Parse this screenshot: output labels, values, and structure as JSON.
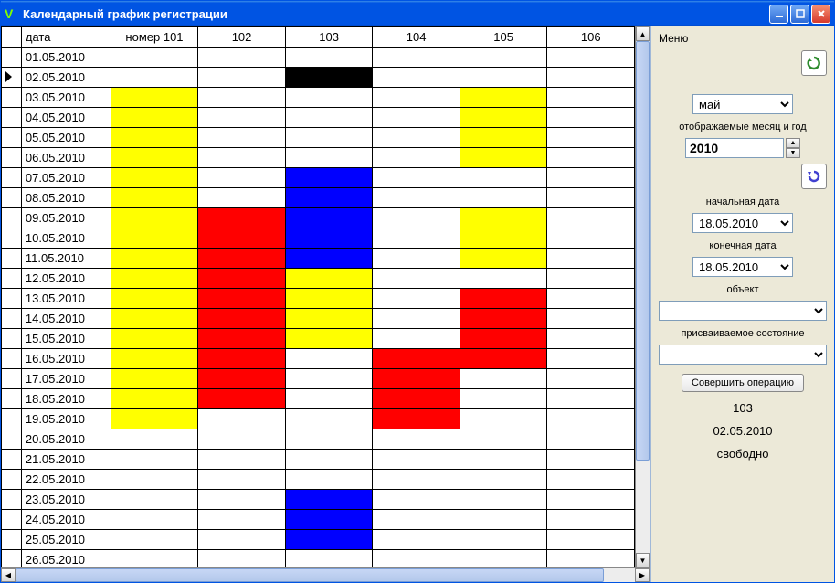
{
  "window": {
    "title": "Календарный график регистрации"
  },
  "grid": {
    "headers": [
      "дата",
      "номер 101",
      "102",
      "103",
      "104",
      "105",
      "106"
    ],
    "selected_row_index": 1,
    "rows": [
      {
        "date": "01.05.2010",
        "cells": [
          "",
          "",
          "",
          "",
          "",
          ""
        ]
      },
      {
        "date": "02.05.2010",
        "cells": [
          "",
          "",
          "black",
          "",
          "",
          ""
        ]
      },
      {
        "date": "03.05.2010",
        "cells": [
          "yellow",
          "",
          "",
          "",
          "yellow",
          ""
        ]
      },
      {
        "date": "04.05.2010",
        "cells": [
          "yellow",
          "",
          "",
          "",
          "yellow",
          ""
        ]
      },
      {
        "date": "05.05.2010",
        "cells": [
          "yellow",
          "",
          "",
          "",
          "yellow",
          ""
        ]
      },
      {
        "date": "06.05.2010",
        "cells": [
          "yellow",
          "",
          "",
          "",
          "yellow",
          ""
        ]
      },
      {
        "date": "07.05.2010",
        "cells": [
          "yellow",
          "",
          "blue",
          "",
          "",
          ""
        ]
      },
      {
        "date": "08.05.2010",
        "cells": [
          "yellow",
          "",
          "blue",
          "",
          "",
          ""
        ]
      },
      {
        "date": "09.05.2010",
        "cells": [
          "yellow",
          "red",
          "blue",
          "",
          "yellow",
          ""
        ]
      },
      {
        "date": "10.05.2010",
        "cells": [
          "yellow",
          "red",
          "blue",
          "",
          "yellow",
          ""
        ]
      },
      {
        "date": "11.05.2010",
        "cells": [
          "yellow",
          "red",
          "blue",
          "",
          "yellow",
          ""
        ]
      },
      {
        "date": "12.05.2010",
        "cells": [
          "yellow",
          "red",
          "yellow",
          "",
          "",
          ""
        ]
      },
      {
        "date": "13.05.2010",
        "cells": [
          "yellow",
          "red",
          "yellow",
          "",
          "red",
          ""
        ]
      },
      {
        "date": "14.05.2010",
        "cells": [
          "yellow",
          "red",
          "yellow",
          "",
          "red",
          ""
        ]
      },
      {
        "date": "15.05.2010",
        "cells": [
          "yellow",
          "red",
          "yellow",
          "",
          "red",
          ""
        ]
      },
      {
        "date": "16.05.2010",
        "cells": [
          "yellow",
          "red",
          "",
          "red",
          "red",
          ""
        ]
      },
      {
        "date": "17.05.2010",
        "cells": [
          "yellow",
          "red",
          "",
          "red",
          "",
          ""
        ]
      },
      {
        "date": "18.05.2010",
        "cells": [
          "yellow",
          "red",
          "",
          "red",
          "",
          ""
        ]
      },
      {
        "date": "19.05.2010",
        "cells": [
          "yellow",
          "",
          "",
          "red",
          "",
          ""
        ]
      },
      {
        "date": "20.05.2010",
        "cells": [
          "",
          "",
          "",
          "",
          "",
          ""
        ]
      },
      {
        "date": "21.05.2010",
        "cells": [
          "",
          "",
          "",
          "",
          "",
          ""
        ]
      },
      {
        "date": "22.05.2010",
        "cells": [
          "",
          "",
          "",
          "",
          "",
          ""
        ]
      },
      {
        "date": "23.05.2010",
        "cells": [
          "",
          "",
          "blue",
          "",
          "",
          ""
        ]
      },
      {
        "date": "24.05.2010",
        "cells": [
          "",
          "",
          "blue",
          "",
          "",
          ""
        ]
      },
      {
        "date": "25.05.2010",
        "cells": [
          "",
          "",
          "blue",
          "",
          "",
          ""
        ]
      },
      {
        "date": "26.05.2010",
        "cells": [
          "",
          "",
          "",
          "",
          "",
          ""
        ]
      }
    ]
  },
  "panel": {
    "menu_label": "Меню",
    "month_value": "май",
    "month_year_label": "отображаемые месяц и год",
    "year_value": "2010",
    "start_date_label": "начальная дата",
    "start_date_value": "18.05.2010",
    "end_date_label": "конечная дата",
    "end_date_value": "18.05.2010",
    "object_label": "объект",
    "object_value": "",
    "state_label": "присваиваемое состояние",
    "state_value": "",
    "submit_label": "Совершить операцию",
    "status_room": "103",
    "status_date": "02.05.2010",
    "status_state": "свободно"
  }
}
